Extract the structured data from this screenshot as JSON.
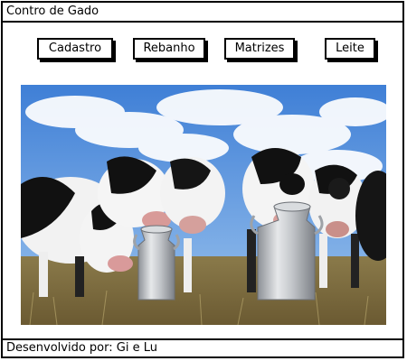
{
  "window": {
    "title": "Contro de Gado"
  },
  "nav": {
    "cadastro_label": "Cadastro",
    "rebanho_label": "Rebanho",
    "matrizes_label": "Matrizes",
    "leite_label": "Leite"
  },
  "image": {
    "subject": "Holstein cows with two aluminium milk cans in a field"
  },
  "footer": {
    "text": "Desenvolvido por: Gi e Lu"
  }
}
